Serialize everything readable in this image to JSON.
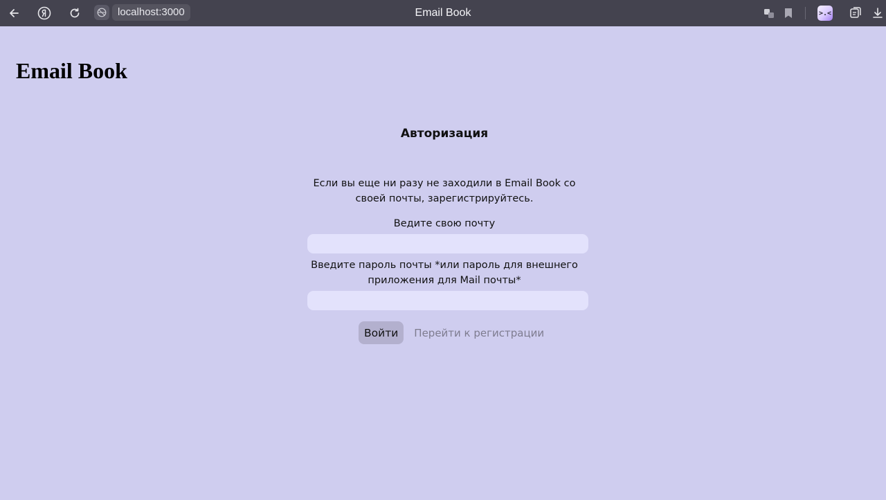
{
  "browser": {
    "url": "localhost:3000",
    "tab_title": "Email Book",
    "icons": [
      "back-arrow-icon",
      "yandex-logo-icon",
      "reload-icon",
      "site-info-icon",
      "translate-icon",
      "bookmark-icon",
      "profile-avatar-icon",
      "collections-icon",
      "download-icon"
    ],
    "avatar_glyph": ">.<"
  },
  "page": {
    "heading": "Email Book"
  },
  "auth": {
    "title": "Авторизация",
    "note": "Если вы еще ни разу не заходили в Email Book со своей почты, зарегистрируйтесь.",
    "email_label": "Ведите свою почту",
    "email_value": "",
    "password_label": "Введите пароль почты *или пароль для внешнего приложения для Mail почты*",
    "password_value": "",
    "login_button": "Войти",
    "register_link": "Перейти к регистрации"
  },
  "colors": {
    "page_background": "#cfcdef",
    "browser_bar": "#44434f",
    "input_background": "#e3e2fc",
    "login_button": "#b3b0ce",
    "register_link": "#7e7c8f"
  }
}
